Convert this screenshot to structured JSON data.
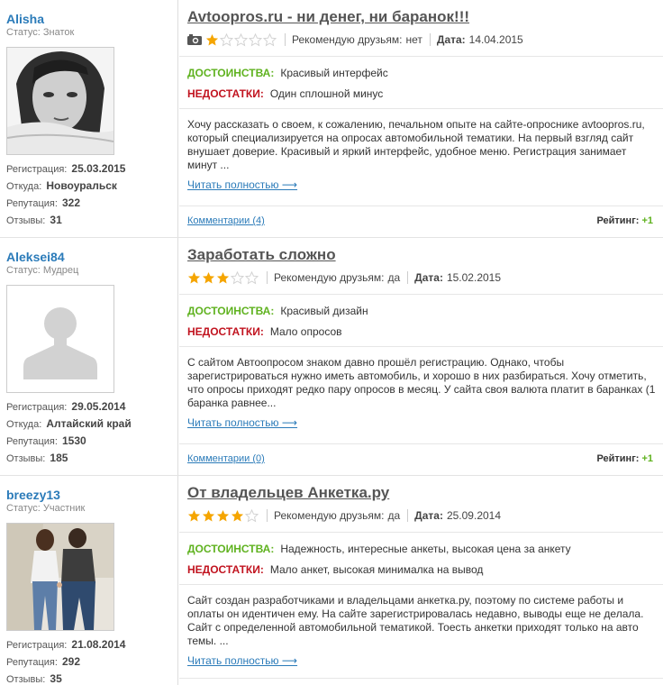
{
  "reviews": [
    {
      "user": {
        "name": "Alisha",
        "status": "Статус: Знаток",
        "avatar": "woman-photo",
        "stats": [
          {
            "label": "Регистрация:",
            "value": "25.03.2015"
          },
          {
            "label": "Откуда:",
            "value": "Новоуральск"
          },
          {
            "label": "Репутация:",
            "value": "322"
          },
          {
            "label": "Отзывы:",
            "value": "31"
          }
        ]
      },
      "title": "Avtoopros.ru - ни денег, ни баранок!!!",
      "has_photo_icon": true,
      "stars": 1,
      "recommend_label": "Рекомендую друзьям:",
      "recommend": "нет",
      "date_label": "Дата:",
      "date": "14.04.2015",
      "pros_label": "ДОСТОИНСТВА:",
      "pros": "Красивый интерфейс",
      "cons_label": "НЕДОСТАТКИ:",
      "cons": "Один сплошной минус",
      "text": "Хочу рассказать о своем, к сожалению, печальном опыте на сайте-опроснике avtoopros.ru, который специализируется на опросах автомобильной тематики. На первый взгляд сайт внушает доверие. Красивый и яркий интерфейс, удобное меню. Регистрация занимает минут ...",
      "read_more": "Читать полностью ⟶",
      "comments": "Комментарии (4)",
      "rating_label": "Рейтинг:",
      "rating": "+1"
    },
    {
      "user": {
        "name": "Aleksei84",
        "status": "Статус: Мудрец",
        "avatar": "default-silhouette",
        "stats": [
          {
            "label": "Регистрация:",
            "value": "29.05.2014"
          },
          {
            "label": "Откуда:",
            "value": "Алтайский край"
          },
          {
            "label": "Репутация:",
            "value": "1530"
          },
          {
            "label": "Отзывы:",
            "value": "185"
          }
        ]
      },
      "title": "Заработать сложно",
      "has_photo_icon": false,
      "stars": 3,
      "recommend_label": "Рекомендую друзьям:",
      "recommend": "да",
      "date_label": "Дата:",
      "date": "15.02.2015",
      "pros_label": "ДОСТОИНСТВА:",
      "pros": "Красивый дизайн",
      "cons_label": "НЕДОСТАТКИ:",
      "cons": "Мало опросов",
      "text": "С сайтом Автоопросом знаком давно прошёл регистрацию. Однако, чтобы зарегистрироваться нужно иметь автомобиль, и хорошо в них разбираться. Хочу отметить, что опросы приходят редко пару опросов в месяц. У сайта своя валюта платит в баранках (1 баранка равнее...",
      "read_more": "Читать полностью ⟶",
      "comments": "Комментарии (0)",
      "rating_label": "Рейтинг:",
      "rating": "+1"
    },
    {
      "user": {
        "name": "breezy13",
        "status": "Статус: Участник",
        "avatar": "couple-photo",
        "stats": [
          {
            "label": "Регистрация:",
            "value": "21.08.2014"
          },
          {
            "label": "Репутация:",
            "value": "292"
          },
          {
            "label": "Отзывы:",
            "value": "35"
          }
        ]
      },
      "title": "От владельцев Анкетка.ру",
      "has_photo_icon": false,
      "stars": 4,
      "recommend_label": "Рекомендую друзьям:",
      "recommend": "да",
      "date_label": "Дата:",
      "date": "25.09.2014",
      "pros_label": "ДОСТОИНСТВА:",
      "pros": "Надежность, интересные анкеты, высокая цена за анкету",
      "cons_label": "НЕДОСТАТКИ:",
      "cons": "Мало анкет, высокая минималка на вывод",
      "text": "Сайт создан разработчиками и владельцами анкетка.ру, поэтому по системе работы и оплаты он идентичен ему. На сайте зарегистрировалась недавно, выводы еще не делала. Сайт с определенной автомобильной тематикой. Тоесть анкетки приходят только на авто темы. ...",
      "read_more": "Читать полностью ⟶"
    }
  ],
  "colors": {
    "star_filled": "#f5a500",
    "star_empty": "#d0d0d0",
    "pros": "#5fb21f",
    "cons": "#c1131f",
    "link": "#2b7bb9"
  }
}
